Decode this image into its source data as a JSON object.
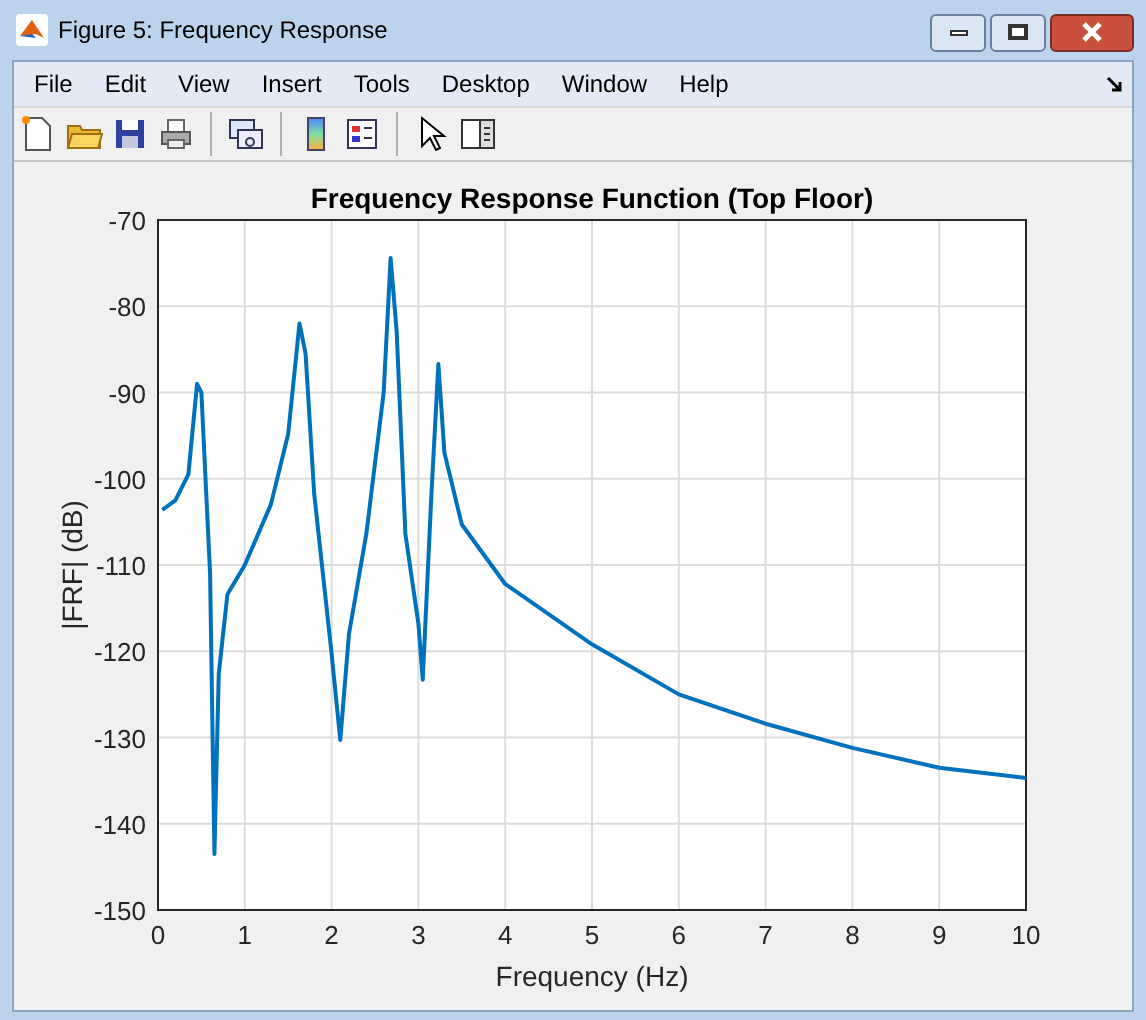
{
  "window": {
    "title": "Figure 5: Frequency Response"
  },
  "menu": [
    "File",
    "Edit",
    "View",
    "Insert",
    "Tools",
    "Desktop",
    "Window",
    "Help"
  ],
  "chart_data": {
    "type": "line",
    "title": "Frequency Response Function (Top Floor)",
    "xlabel": "Frequency (Hz)",
    "ylabel": "|FRF| (dB)",
    "xlim": [
      0,
      10
    ],
    "ylim": [
      -150,
      -70
    ],
    "xticks": [
      0,
      1,
      2,
      3,
      4,
      5,
      6,
      7,
      8,
      9,
      10
    ],
    "yticks": [
      -150,
      -140,
      -130,
      -120,
      -110,
      -100,
      -90,
      -80,
      -70
    ],
    "x": [
      0.05,
      0.2,
      0.35,
      0.45,
      0.5,
      0.6,
      0.65,
      0.7,
      0.8,
      1.0,
      1.3,
      1.5,
      1.63,
      1.7,
      1.8,
      2.0,
      2.1,
      2.2,
      2.4,
      2.6,
      2.68,
      2.75,
      2.85,
      3.0,
      3.05,
      3.15,
      3.23,
      3.3,
      3.5,
      4,
      5,
      6,
      7,
      8,
      9,
      10
    ],
    "grid": true,
    "series": [
      {
        "color": "#0072bd",
        "values": [
          -103.6,
          -102.5,
          -99.5,
          -89,
          -90,
          -111,
          -143.5,
          -122.6,
          -113.4,
          -110,
          -103,
          -94.8,
          -82,
          -85.5,
          -101.8,
          -120.3,
          -130.3,
          -118,
          -106.4,
          -90,
          -74.4,
          -83,
          -106.4,
          -116.8,
          -123.3,
          -101.8,
          -86.7,
          -97,
          -105.3,
          -112.2,
          -119.2,
          -125,
          -128.4,
          -131.2,
          -133.5,
          -134.7
        ]
      }
    ]
  }
}
